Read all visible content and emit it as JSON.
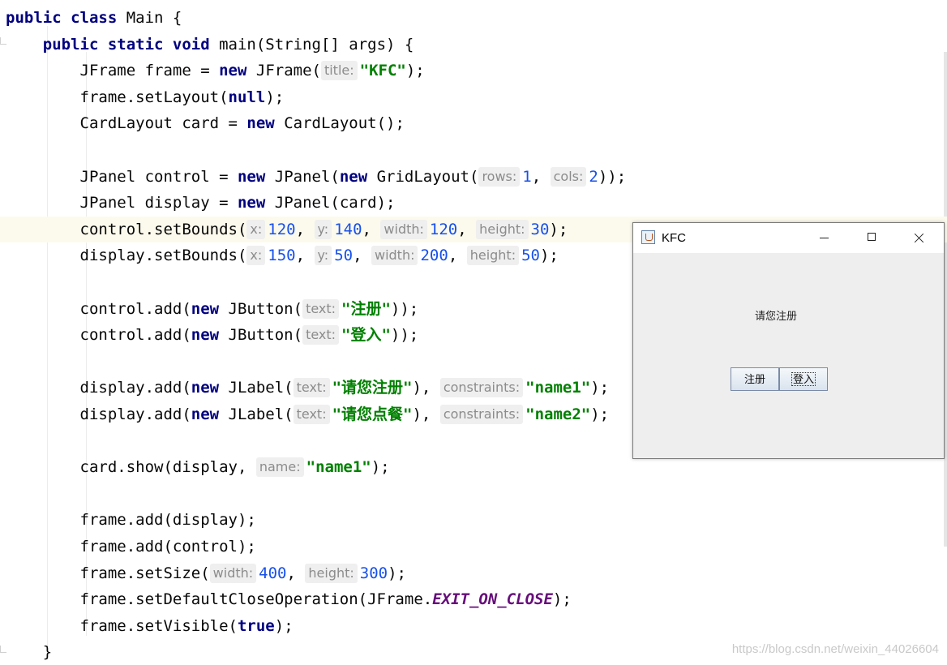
{
  "code": {
    "lines": [
      {
        "t": [
          [
            "kw",
            "public class "
          ],
          [
            "p",
            "Main {"
          ]
        ]
      },
      {
        "t": [
          [
            "p",
            "    "
          ],
          [
            "kw",
            "public static void "
          ],
          [
            "p",
            "main(String[] args) {"
          ]
        ]
      },
      {
        "t": [
          [
            "p",
            "        JFrame frame = "
          ],
          [
            "kw",
            "new "
          ],
          [
            "p",
            "JFrame("
          ],
          [
            "h",
            "title:"
          ],
          [
            "str",
            "\"KFC\""
          ],
          [
            "p",
            ");"
          ]
        ]
      },
      {
        "t": [
          [
            "p",
            "        frame.setLayout("
          ],
          [
            "kw",
            "null"
          ],
          [
            "p",
            ");"
          ]
        ]
      },
      {
        "t": [
          [
            "p",
            "        CardLayout card = "
          ],
          [
            "kw",
            "new "
          ],
          [
            "p",
            "CardLayout();"
          ]
        ]
      },
      {
        "t": []
      },
      {
        "t": [
          [
            "p",
            "        JPanel control = "
          ],
          [
            "kw",
            "new "
          ],
          [
            "p",
            "JPanel("
          ],
          [
            "kw",
            "new "
          ],
          [
            "p",
            "GridLayout("
          ],
          [
            "h",
            "rows:"
          ],
          [
            "num",
            "1"
          ],
          [
            "p",
            ", "
          ],
          [
            "h",
            "cols:"
          ],
          [
            "num",
            "2"
          ],
          [
            "p",
            "));"
          ]
        ]
      },
      {
        "t": [
          [
            "p",
            "        JPanel display = "
          ],
          [
            "kw",
            "new "
          ],
          [
            "p",
            "JPanel(card);"
          ]
        ]
      },
      {
        "t": [
          [
            "p",
            "        control.setBounds("
          ],
          [
            "h",
            "x:"
          ],
          [
            "num",
            "120"
          ],
          [
            "p",
            ", "
          ],
          [
            "h",
            "y:"
          ],
          [
            "num",
            "140"
          ],
          [
            "p",
            ", "
          ],
          [
            "h",
            "width:"
          ],
          [
            "num",
            "120"
          ],
          [
            "p",
            ", "
          ],
          [
            "h",
            "height:"
          ],
          [
            "num",
            "30"
          ],
          [
            "p",
            ");"
          ]
        ],
        "hl": true
      },
      {
        "t": [
          [
            "p",
            "        display.setBounds("
          ],
          [
            "h",
            "x:"
          ],
          [
            "num",
            "150"
          ],
          [
            "p",
            ", "
          ],
          [
            "h",
            "y:"
          ],
          [
            "num",
            "50"
          ],
          [
            "p",
            ", "
          ],
          [
            "h",
            "width:"
          ],
          [
            "num",
            "200"
          ],
          [
            "p",
            ", "
          ],
          [
            "h",
            "height:"
          ],
          [
            "num",
            "50"
          ],
          [
            "p",
            ");"
          ]
        ]
      },
      {
        "t": []
      },
      {
        "t": [
          [
            "p",
            "        control.add("
          ],
          [
            "kw",
            "new "
          ],
          [
            "p",
            "JButton("
          ],
          [
            "h",
            "text:"
          ],
          [
            "str",
            "\"注册\""
          ],
          [
            "p",
            "));"
          ]
        ]
      },
      {
        "t": [
          [
            "p",
            "        control.add("
          ],
          [
            "kw",
            "new "
          ],
          [
            "p",
            "JButton("
          ],
          [
            "h",
            "text:"
          ],
          [
            "str",
            "\"登入\""
          ],
          [
            "p",
            "));"
          ]
        ]
      },
      {
        "t": []
      },
      {
        "t": [
          [
            "p",
            "        display.add("
          ],
          [
            "kw",
            "new "
          ],
          [
            "p",
            "JLabel("
          ],
          [
            "h",
            "text:"
          ],
          [
            "str",
            "\"请您注册\""
          ],
          [
            "p",
            "), "
          ],
          [
            "h",
            "constraints:"
          ],
          [
            "str",
            "\"name1\""
          ],
          [
            "p",
            ");"
          ]
        ]
      },
      {
        "t": [
          [
            "p",
            "        display.add("
          ],
          [
            "kw",
            "new "
          ],
          [
            "p",
            "JLabel("
          ],
          [
            "h",
            "text:"
          ],
          [
            "str",
            "\"请您点餐\""
          ],
          [
            "p",
            "), "
          ],
          [
            "h",
            "constraints:"
          ],
          [
            "str",
            "\"name2\""
          ],
          [
            "p",
            ");"
          ]
        ]
      },
      {
        "t": []
      },
      {
        "t": [
          [
            "p",
            "        card.show(display, "
          ],
          [
            "h",
            "name:"
          ],
          [
            "str",
            "\"name1\""
          ],
          [
            "p",
            ");"
          ]
        ]
      },
      {
        "t": []
      },
      {
        "t": [
          [
            "p",
            "        frame.add(display);"
          ]
        ]
      },
      {
        "t": [
          [
            "p",
            "        frame.add(control);"
          ]
        ]
      },
      {
        "t": [
          [
            "p",
            "        frame.setSize("
          ],
          [
            "h",
            "width:"
          ],
          [
            "num",
            "400"
          ],
          [
            "p",
            ", "
          ],
          [
            "h",
            "height:"
          ],
          [
            "num",
            "300"
          ],
          [
            "p",
            ");"
          ]
        ]
      },
      {
        "t": [
          [
            "p",
            "        frame.setDefaultCloseOperation(JFrame."
          ],
          [
            "const",
            "EXIT_ON_CLOSE"
          ],
          [
            "p",
            ");"
          ]
        ]
      },
      {
        "t": [
          [
            "p",
            "        frame.setVisible("
          ],
          [
            "kw",
            "true"
          ],
          [
            "p",
            ");"
          ]
        ]
      },
      {
        "t": [
          [
            "p",
            "    }"
          ]
        ]
      }
    ]
  },
  "window": {
    "title": "KFC",
    "label": "请您注册",
    "buttons": [
      "注册",
      "登入"
    ]
  },
  "watermark": "https://blog.csdn.net/weixin_44026604",
  "colors": {
    "keyword": "#000080",
    "string": "#008000",
    "number": "#1750eb",
    "hint_bg": "#efefef"
  }
}
